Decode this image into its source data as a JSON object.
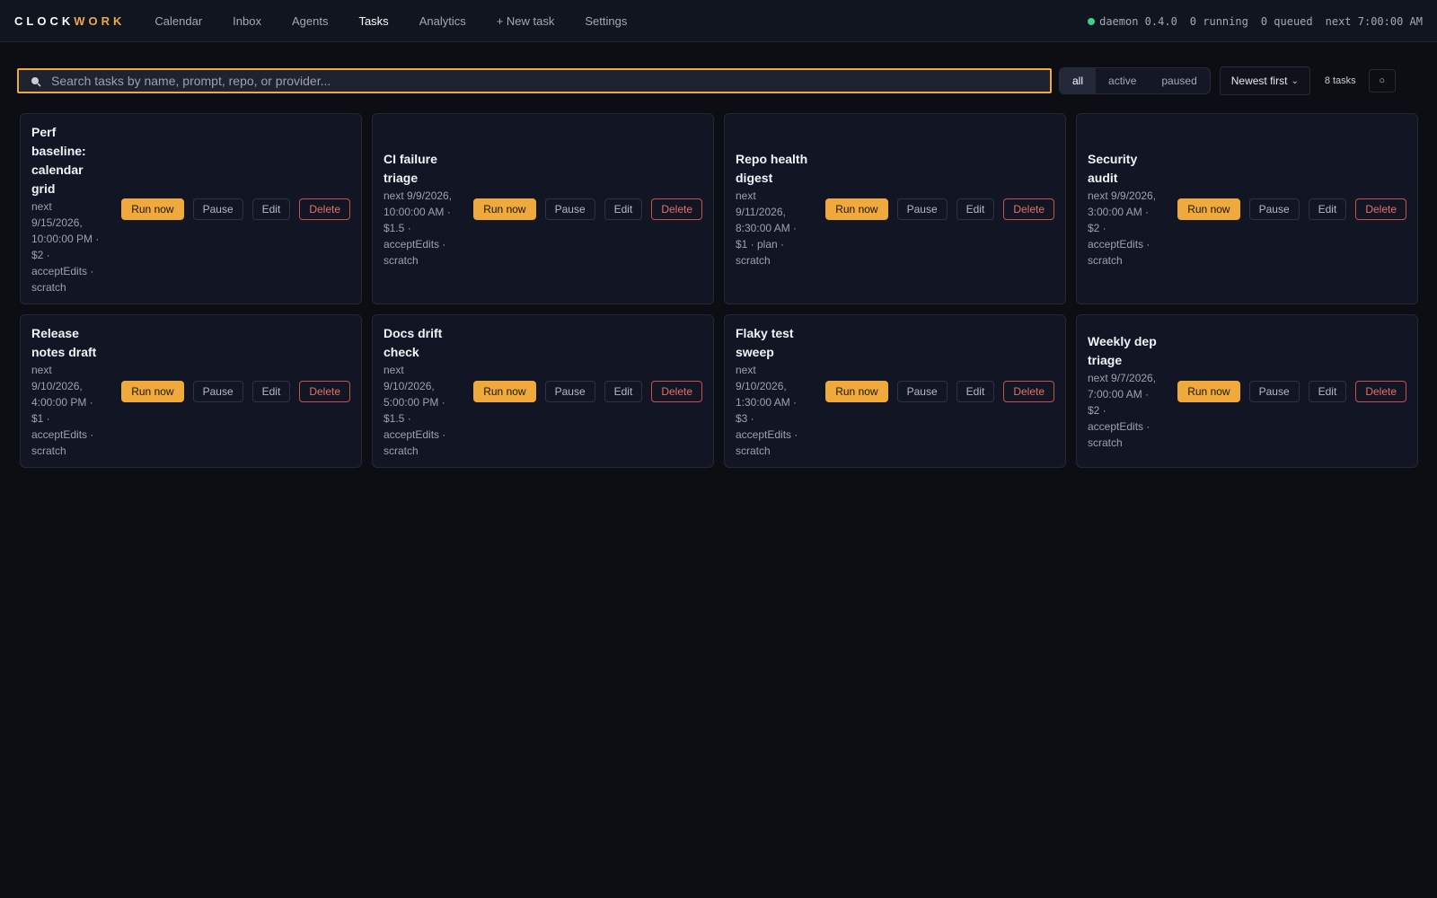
{
  "brand": {
    "part1": "CLOCK",
    "part2": "WORK"
  },
  "nav": [
    "Calendar",
    "Inbox",
    "Agents",
    "Tasks",
    "Analytics",
    "+ New task",
    "Settings"
  ],
  "nav_active": "Tasks",
  "status": {
    "daemon": "daemon 0.4.0",
    "running": "0 running",
    "queued": "0 queued",
    "next": "next 7:00:00 AM"
  },
  "search": {
    "placeholder": "Search tasks by name, prompt, repo, or provider..."
  },
  "filters": [
    "all",
    "active",
    "paused"
  ],
  "filter_active": "all",
  "sort": {
    "label": "Newest first"
  },
  "count": "8 tasks",
  "settings_glyph": "○",
  "actions": {
    "run": "Run now",
    "pause": "Pause",
    "edit": "Edit",
    "delete": "Delete"
  },
  "tasks": [
    {
      "title": [
        "Perf",
        "baseline:",
        "calendar",
        "grid"
      ],
      "meta": [
        "next",
        "9/15/2026,",
        "10:00:00 PM ·",
        "$2 ·",
        "acceptEdits ·",
        "scratch"
      ]
    },
    {
      "title": [
        "CI failure",
        "triage"
      ],
      "meta": [
        "next 9/9/2026,",
        "10:00:00 AM ·",
        "$1.5 ·",
        "acceptEdits ·",
        "scratch"
      ]
    },
    {
      "title": [
        "Repo health",
        "digest"
      ],
      "meta": [
        "next",
        "9/11/2026,",
        "8:30:00 AM ·",
        "$1 · plan ·",
        "scratch"
      ]
    },
    {
      "title": [
        "Security",
        "audit"
      ],
      "meta": [
        "next 9/9/2026,",
        "3:00:00 AM ·",
        "$2 ·",
        "acceptEdits ·",
        "scratch"
      ]
    },
    {
      "title": [
        "Release",
        "notes draft"
      ],
      "meta": [
        "next",
        "9/10/2026,",
        "4:00:00 PM ·",
        "$1 ·",
        "acceptEdits ·",
        "scratch"
      ]
    },
    {
      "title": [
        "Docs drift",
        "check"
      ],
      "meta": [
        "next",
        "9/10/2026,",
        "5:00:00 PM ·",
        "$1.5 ·",
        "acceptEdits ·",
        "scratch"
      ]
    },
    {
      "title": [
        "Flaky test",
        "sweep"
      ],
      "meta": [
        "next",
        "9/10/2026,",
        "1:30:00 AM ·",
        "$3 ·",
        "acceptEdits ·",
        "scratch"
      ]
    },
    {
      "title": [
        "Weekly dep",
        "triage"
      ],
      "meta": [
        "next 9/7/2026,",
        "7:00:00 AM ·",
        "$2 ·",
        "acceptEdits ·",
        "scratch"
      ]
    }
  ],
  "colors": {
    "accent": "#f0a93b",
    "danger": "#e86f6d",
    "status_ok": "#3ecf8e",
    "background": "#0c0e13",
    "card": "#121624"
  }
}
